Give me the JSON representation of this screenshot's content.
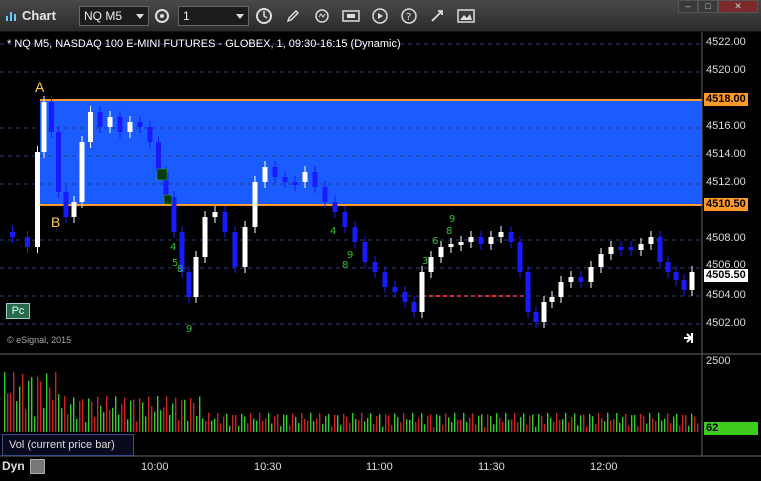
{
  "window": {
    "title": "Chart",
    "symbol": "NQ M5",
    "interval": "1"
  },
  "toolbar": {
    "icons": [
      "settings-gear-icon",
      "clock-icon",
      "pencil-icon",
      "refresh-icon",
      "dollar-icon",
      "play-icon",
      "help-icon",
      "link-icon",
      "image-icon"
    ]
  },
  "chart": {
    "title": "* NQ M5, NASDAQ 100 E-MINI FUTURES - GLOBEX, 1, 09:30-16:15 (Dynamic)",
    "copyright": "© eSignal, 2015",
    "pc_label": "Pc",
    "annotation_a": "A",
    "annotation_b": "B",
    "price_axis": [
      "4522.00",
      "4520.00",
      "4518.00",
      "4516.00",
      "4514.00",
      "4512.00",
      "4510.50",
      "4508.00",
      "4506.00",
      "4505.50",
      "4504.00",
      "4502.00"
    ],
    "level_high": "4518.00",
    "level_low": "4510.50",
    "last_price": "4505.50",
    "time_axis": [
      "10:00",
      "10:30",
      "11:00",
      "11:30",
      "12:00"
    ],
    "colors": {
      "band": "#1a5cff",
      "level_line": "#ff9a2a",
      "up": "#ffffff",
      "down": "#1a1aff",
      "support": "#ff2020"
    }
  },
  "volume": {
    "label": "Vol (current price bar)",
    "axis_top": "2500",
    "last_value": "62"
  },
  "footer": {
    "dyn_label": "Dyn"
  }
}
